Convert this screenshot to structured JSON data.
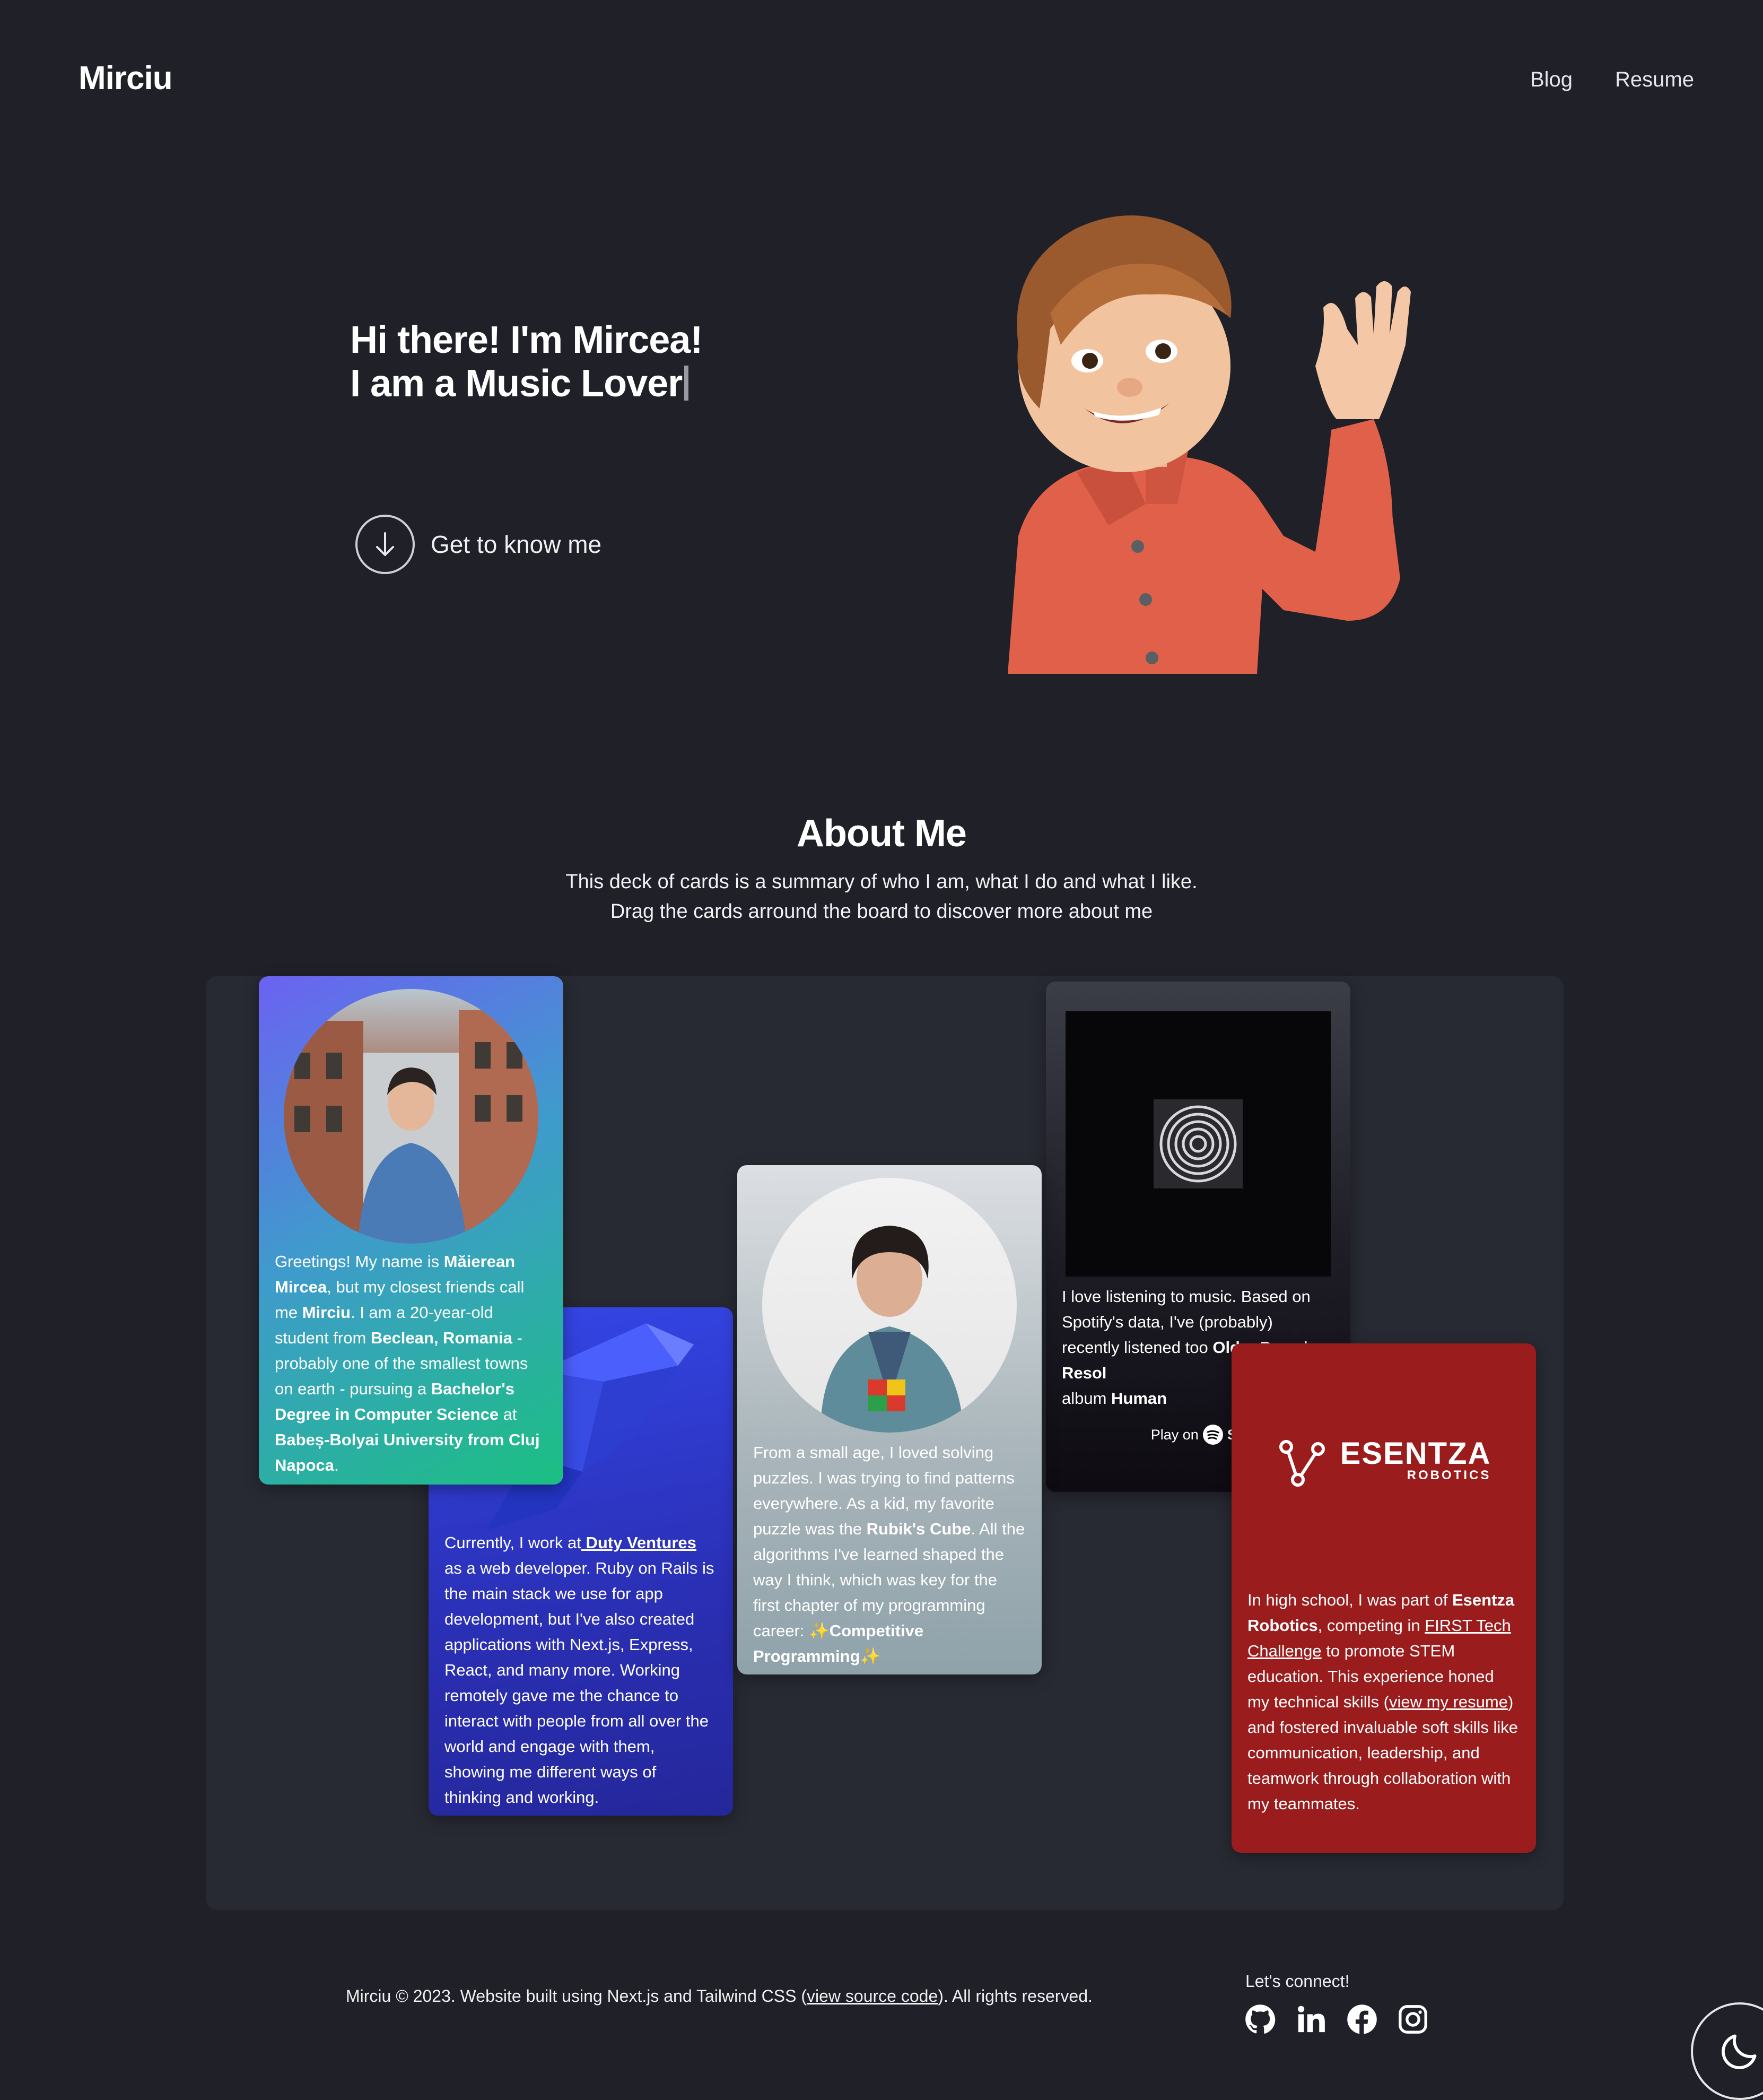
{
  "header": {
    "logo": "Mirciu",
    "nav": [
      "Blog",
      "Resume"
    ]
  },
  "hero": {
    "line1": "Hi there! I'm Mircea!",
    "line2": "I am a Music Lover",
    "cta_label": "Get to know me"
  },
  "about": {
    "title": "About Me",
    "subtitle_line1": "This deck of cards is a summary of who I am, what I do and what I like.",
    "subtitle_line2": "Drag the cards arround the board to discover more about me"
  },
  "cards": {
    "intro": {
      "t1": "Greetings! My name is ",
      "b1": "Măierean Mircea",
      "t2": ", but my closest friends call me ",
      "b2": "Mirciu",
      "t3": ". I am a 20-year-old student from ",
      "b3": "Beclean, Romania",
      "t4": " - probably one of the smallest towns on earth - pursuing a ",
      "b4": "Bachelor's Degree in Computer Science",
      "t5": " at ",
      "b5": "Babeș-Bolyai University from Cluj Napoca",
      "t6": "."
    },
    "work": {
      "t1": "Currently, I work at",
      "link": " Duty Ventures",
      "t2": " as a web developer. Ruby on Rails is the main stack we use for app development, but I've also created applications with Next.js, Express, React, and many more. Working remotely gave me the chance to interact with people from all over the world and engage with them, showing me different ways of thinking and working."
    },
    "puzzle": {
      "t1": "From a small age, I loved solving puzzles. I was trying to find patterns everywhere. As a kid, my favorite puzzle was the ",
      "b1": "Rubik's Cube",
      "t2": ". All the algorithms I've learned shaped the way I think, which was key for the first chapter of my programming career: ",
      "sparkle": "✨",
      "b2": "Competitive Programming"
    },
    "music": {
      "t1": "I love listening to music. Based on Spotify's data, I've (probably) recently listened too ",
      "b1": "Older Days",
      "t2": " by ",
      "b2": "Resol",
      "t3": "album ",
      "b3": "Human",
      "play_label": "Play on",
      "spotify_label": "Sp"
    },
    "robotics": {
      "logo_main": "ESENTZA",
      "logo_sub": "ROBOTICS",
      "t1": "In high school, I was part of ",
      "b1": "Esentza Robotics",
      "t2": ", competing in ",
      "link1": "FIRST Tech Challenge",
      "t3": " to promote STEM education. This experience honed my technical skills (",
      "link2": "view my resume",
      "t4": ") and fostered invaluable soft skills like communication, leadership, and teamwork through collaboration with my teammates."
    }
  },
  "footer": {
    "copy_prefix": "Mirciu © 2023. Website built using Next.js and Tailwind CSS (",
    "source_link": "view source code",
    "copy_suffix": "). All rights reserved.",
    "connect_label": "Let's connect!",
    "socials": [
      "github-icon",
      "linkedin-icon",
      "facebook-icon",
      "instagram-icon"
    ]
  },
  "colors": {
    "background": "#1f2028",
    "board": "#282a33",
    "robotics_card": "#9b1c1c",
    "avatar_shirt": "#e0604a"
  }
}
